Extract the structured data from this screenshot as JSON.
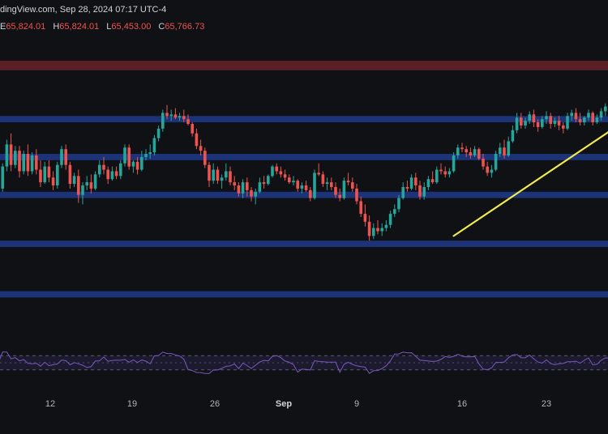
{
  "header": {
    "source_text": "dingView.com, Sep 28, 2024 07:17 UTC-4",
    "ohlc": [
      {
        "label": "E",
        "value": "65,824.01"
      },
      {
        "label": "H",
        "value": "65,824.01"
      },
      {
        "label": "L",
        "value": "65,453.00"
      },
      {
        "label": "C",
        "value": "65,766.73"
      }
    ]
  },
  "colors": {
    "background": "#0f1114",
    "up": "#26a69a",
    "down": "#ef5350",
    "resistance_zone": "#5c1f26",
    "support_zone": "#1d3377",
    "trendline": "#f2ea4a",
    "rsi_line": "#7e57c2",
    "rsi_band": "#1c1a2e"
  },
  "chart_data": {
    "type": "candlestick",
    "x_axis": {
      "ticks": [
        {
          "label": "12",
          "major": false
        },
        {
          "label": "19",
          "major": false
        },
        {
          "label": "26",
          "major": false
        },
        {
          "label": "Sep",
          "major": true
        },
        {
          "label": "9",
          "major": false
        },
        {
          "label": "16",
          "major": false
        },
        {
          "label": "23",
          "major": false
        }
      ]
    },
    "y_range": [
      51000,
      70500
    ],
    "resistance_zones": [
      [
        68100,
        68700
      ]
    ],
    "support_zones": [
      [
        64800,
        65200
      ],
      [
        62400,
        62800
      ],
      [
        60000,
        60400
      ],
      [
        56900,
        57300
      ],
      [
        53700,
        54100
      ]
    ],
    "trendline": {
      "start": {
        "index": 108,
        "price": 57600
      },
      "end": {
        "index": 149,
        "price": 64950
      }
    },
    "rsi": {
      "range": [
        0,
        100
      ],
      "upper": 70,
      "lower": 30
    },
    "candles": [
      [
        59000,
        60800,
        58700,
        60600
      ],
      [
        60600,
        62200,
        60400,
        62000
      ],
      [
        62000,
        63700,
        61700,
        63400
      ],
      [
        63400,
        64100,
        61700,
        62100
      ],
      [
        62100,
        63300,
        61900,
        63000
      ],
      [
        63000,
        63300,
        61300,
        61700
      ],
      [
        61700,
        63000,
        61500,
        62800
      ],
      [
        62800,
        63400,
        61400,
        61700
      ],
      [
        61700,
        62900,
        61500,
        62700
      ],
      [
        62700,
        63100,
        61500,
        61800
      ],
      [
        61800,
        62400,
        60700,
        61000
      ],
      [
        61000,
        62300,
        60900,
        62000
      ],
      [
        62000,
        62400,
        61000,
        61300
      ],
      [
        61300,
        61700,
        60500,
        60800
      ],
      [
        60800,
        62300,
        60600,
        62100
      ],
      [
        62100,
        63300,
        61900,
        63100
      ],
      [
        63100,
        63400,
        61800,
        62100
      ],
      [
        62100,
        62300,
        60600,
        60900
      ],
      [
        60900,
        61600,
        60700,
        61400
      ],
      [
        61400,
        61800,
        59700,
        60200
      ],
      [
        60200,
        61000,
        59600,
        60800
      ],
      [
        60800,
        61400,
        60500,
        61000
      ],
      [
        61000,
        61500,
        60300,
        60600
      ],
      [
        60600,
        61700,
        60500,
        61500
      ],
      [
        61500,
        62400,
        61300,
        62100
      ],
      [
        62100,
        62600,
        61500,
        61800
      ],
      [
        61800,
        62000,
        60900,
        61200
      ],
      [
        61200,
        62000,
        61100,
        61700
      ],
      [
        61700,
        62000,
        61200,
        61400
      ],
      [
        61400,
        62400,
        61200,
        62200
      ],
      [
        62200,
        63400,
        62000,
        63200
      ],
      [
        63200,
        63400,
        61800,
        62000
      ],
      [
        62000,
        62400,
        61600,
        62300
      ],
      [
        62300,
        62600,
        61500,
        61800
      ],
      [
        61800,
        63000,
        61700,
        62600
      ],
      [
        62600,
        63100,
        62400,
        62800
      ],
      [
        62800,
        63400,
        62500,
        62900
      ],
      [
        62900,
        64000,
        62700,
        63800
      ],
      [
        63800,
        64600,
        63600,
        64400
      ],
      [
        64400,
        65600,
        64200,
        65400
      ],
      [
        65400,
        65900,
        65000,
        65200
      ],
      [
        65200,
        65600,
        64900,
        65300
      ],
      [
        65300,
        65700,
        65000,
        65100
      ],
      [
        65100,
        65400,
        64900,
        65200
      ],
      [
        65200,
        65600,
        64800,
        65000
      ],
      [
        65000,
        65300,
        64600,
        64700
      ],
      [
        64700,
        64800,
        63900,
        64100
      ],
      [
        64100,
        64400,
        63100,
        63300
      ],
      [
        63300,
        63700,
        62700,
        63000
      ],
      [
        63000,
        63200,
        61900,
        62100
      ],
      [
        62100,
        62300,
        60700,
        61100
      ],
      [
        61100,
        62200,
        60900,
        61800
      ],
      [
        61800,
        62000,
        60900,
        61100
      ],
      [
        61100,
        61500,
        60600,
        61300
      ],
      [
        61300,
        62200,
        61100,
        61700
      ],
      [
        61700,
        62000,
        60800,
        61000
      ],
      [
        61000,
        61400,
        60500,
        60800
      ],
      [
        60800,
        61000,
        60100,
        60300
      ],
      [
        60300,
        61200,
        60000,
        61000
      ],
      [
        61000,
        61300,
        60100,
        60500
      ],
      [
        60500,
        60700,
        59800,
        60100
      ],
      [
        60100,
        60600,
        59600,
        60400
      ],
      [
        60400,
        61300,
        60300,
        61000
      ],
      [
        61000,
        61400,
        60600,
        60900
      ],
      [
        60900,
        61500,
        60800,
        61400
      ],
      [
        61400,
        62100,
        61300,
        62000
      ],
      [
        62000,
        62200,
        61500,
        61700
      ],
      [
        61700,
        62000,
        61300,
        61500
      ],
      [
        61500,
        61800,
        61100,
        61300
      ],
      [
        61300,
        61500,
        60900,
        61000
      ],
      [
        61000,
        61400,
        60800,
        61100
      ],
      [
        61100,
        61200,
        60400,
        60600
      ],
      [
        60600,
        61000,
        60300,
        60800
      ],
      [
        60800,
        61100,
        60400,
        60500
      ],
      [
        60500,
        60700,
        59800,
        60000
      ],
      [
        60000,
        61800,
        59900,
        61600
      ],
      [
        61600,
        62200,
        61400,
        61500
      ],
      [
        61500,
        61700,
        60700,
        60900
      ],
      [
        60900,
        61300,
        60500,
        61000
      ],
      [
        61000,
        61300,
        60500,
        60700
      ],
      [
        60700,
        61000,
        60000,
        60200
      ],
      [
        60200,
        60600,
        59800,
        60000
      ],
      [
        60000,
        61300,
        59900,
        61100
      ],
      [
        61100,
        61600,
        60800,
        61000
      ],
      [
        61000,
        61300,
        60400,
        60600
      ],
      [
        60600,
        60900,
        59600,
        59800
      ],
      [
        59800,
        60100,
        58800,
        59000
      ],
      [
        59000,
        59600,
        58200,
        58500
      ],
      [
        58500,
        58900,
        57300,
        57600
      ],
      [
        57600,
        58400,
        57400,
        58100
      ],
      [
        58100,
        58600,
        57700,
        57900
      ],
      [
        57900,
        58400,
        57600,
        58100
      ],
      [
        58100,
        58600,
        57900,
        58300
      ],
      [
        58300,
        59200,
        58100,
        59000
      ],
      [
        59000,
        59600,
        58800,
        59300
      ],
      [
        59300,
        60200,
        59100,
        60000
      ],
      [
        60000,
        61000,
        59900,
        60700
      ],
      [
        60700,
        61100,
        60400,
        60600
      ],
      [
        60600,
        61500,
        60500,
        61300
      ],
      [
        61300,
        61600,
        60500,
        60800
      ],
      [
        60800,
        61100,
        59900,
        60100
      ],
      [
        60100,
        61000,
        59900,
        60700
      ],
      [
        60700,
        61400,
        60500,
        61200
      ],
      [
        61200,
        61700,
        60900,
        61000
      ],
      [
        61000,
        62000,
        60900,
        61800
      ],
      [
        61800,
        62200,
        61500,
        61700
      ],
      [
        61700,
        62000,
        61300,
        61500
      ],
      [
        61500,
        61900,
        61300,
        61700
      ],
      [
        61700,
        62900,
        61600,
        62700
      ],
      [
        62700,
        63400,
        62500,
        63200
      ],
      [
        63200,
        63500,
        62900,
        63100
      ],
      [
        63100,
        63300,
        62600,
        62900
      ],
      [
        62900,
        63200,
        62500,
        62700
      ],
      [
        62700,
        63300,
        62600,
        63100
      ],
      [
        63100,
        63200,
        62400,
        62500
      ],
      [
        62500,
        62800,
        61800,
        62000
      ],
      [
        62000,
        62300,
        61400,
        61600
      ],
      [
        61600,
        62100,
        61300,
        61800
      ],
      [
        61800,
        63000,
        61700,
        62800
      ],
      [
        62800,
        63500,
        62600,
        63200
      ],
      [
        63200,
        63700,
        62500,
        62700
      ],
      [
        62700,
        63900,
        62600,
        63600
      ],
      [
        63600,
        64600,
        63500,
        64300
      ],
      [
        64300,
        65400,
        64100,
        65100
      ],
      [
        65100,
        65400,
        64400,
        64600
      ],
      [
        64600,
        65100,
        64400,
        64900
      ],
      [
        64900,
        65500,
        64700,
        65300
      ],
      [
        65300,
        65600,
        64500,
        64800
      ],
      [
        64800,
        65000,
        64200,
        64500
      ],
      [
        64500,
        65200,
        64400,
        65000
      ],
      [
        65000,
        65500,
        64700,
        65200
      ],
      [
        65200,
        65400,
        64400,
        64700
      ],
      [
        64700,
        65100,
        64500,
        64900
      ],
      [
        64900,
        65200,
        64300,
        64600
      ],
      [
        64600,
        64800,
        64100,
        64400
      ],
      [
        64400,
        65400,
        64300,
        65200
      ],
      [
        65200,
        65600,
        64900,
        65400
      ],
      [
        65400,
        65700,
        64800,
        65000
      ],
      [
        65000,
        65400,
        64600,
        64800
      ],
      [
        64800,
        65200,
        64600,
        65100
      ],
      [
        65100,
        65600,
        64900,
        65400
      ],
      [
        65400,
        65500,
        64600,
        64800
      ],
      [
        64800,
        65300,
        64700,
        65100
      ],
      [
        65100,
        65700,
        64900,
        65500
      ],
      [
        65500,
        66000,
        65200,
        65800
      ],
      [
        65800,
        66200,
        65500,
        66000
      ],
      [
        66000,
        66400,
        65600,
        65800
      ],
      [
        65800,
        66500,
        65700,
        66300
      ],
      [
        66300,
        66800,
        66000,
        66600
      ],
      [
        66600,
        66900,
        66100,
        66300
      ],
      [
        66300,
        66400,
        65500,
        65800
      ]
    ]
  }
}
